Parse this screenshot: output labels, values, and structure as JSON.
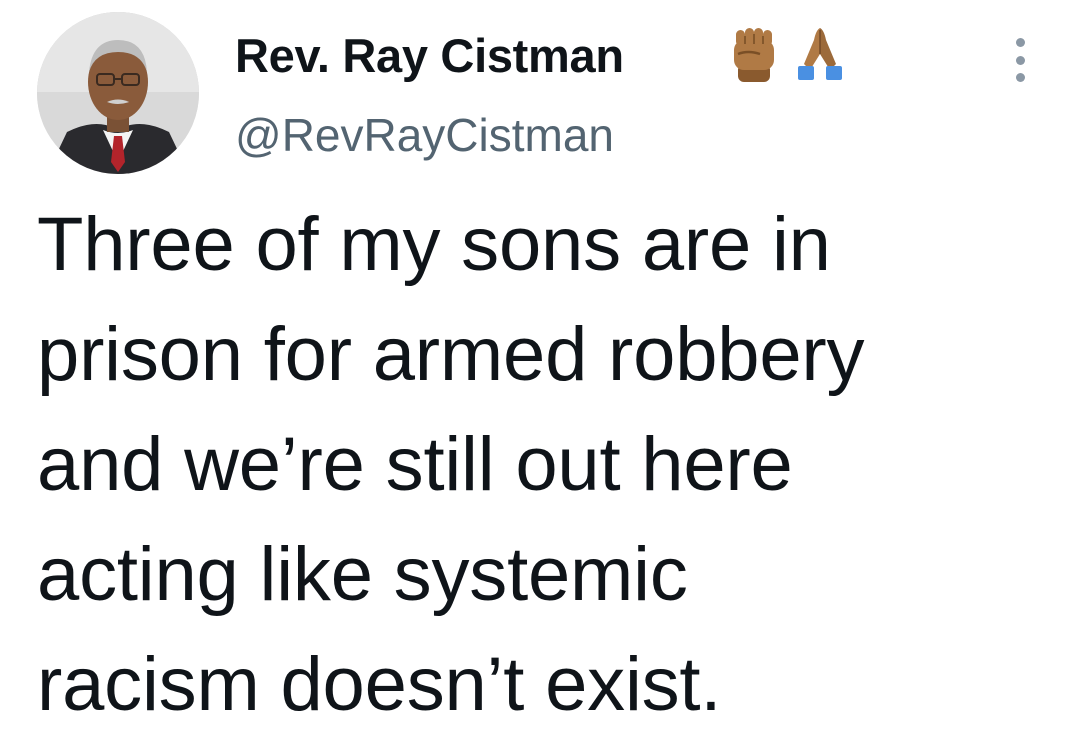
{
  "author": {
    "display_name": "Rev. Ray Cistman",
    "handle": "@RevRayCistman",
    "badges": [
      "raised-fist-emoji-medium-dark-skin",
      "folded-hands-emoji-medium-dark-skin"
    ]
  },
  "tweet": {
    "lines": [
      "Three of my sons are in",
      "prison for armed robbery",
      "and we’re still out here",
      "acting like systemic",
      "racism doesn’t exist."
    ]
  },
  "colors": {
    "text": "#0f1419",
    "secondary": "#536471",
    "skin": "#b07a45",
    "sleeve": "#4a90e2"
  }
}
